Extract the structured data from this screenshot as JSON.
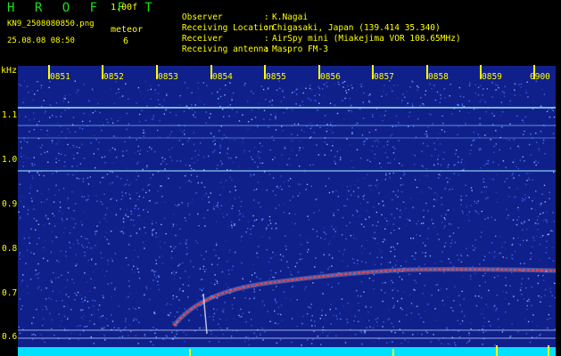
{
  "header": {
    "app_title": "H R O F F T",
    "version": "1.00f",
    "filename": "KN9_2508080850.png",
    "mode": "meteor",
    "timestamp": "25.08.08 08:50",
    "count": "6",
    "info": [
      {
        "label": "Observer",
        "value": "K.Nagai"
      },
      {
        "label": "Receiving Location",
        "value": "Chigasaki, Japan (139.414 35.340)"
      },
      {
        "label": "Receiver",
        "value": "AirSpy mini (Miakejima VOR 108.65MHz)"
      },
      {
        "label": "Receiving antenna",
        "value": "Maspro FM-3"
      }
    ]
  },
  "spectrogram": {
    "unit_label": "kHz",
    "x_labels": [
      "0851",
      "0852",
      "0853",
      "0854",
      "0855",
      "0856",
      "0857",
      "0858",
      "0859",
      "0900"
    ],
    "y_labels": [
      "1.1",
      "1.0",
      "0.9",
      "0.8",
      "0.7",
      "0.6"
    ],
    "colors": {
      "background": "#10208a",
      "trace": "#ff4040",
      "cursor": "#ffff00",
      "baseline": "#00e0ff",
      "line": "#9fe8ff"
    }
  }
}
